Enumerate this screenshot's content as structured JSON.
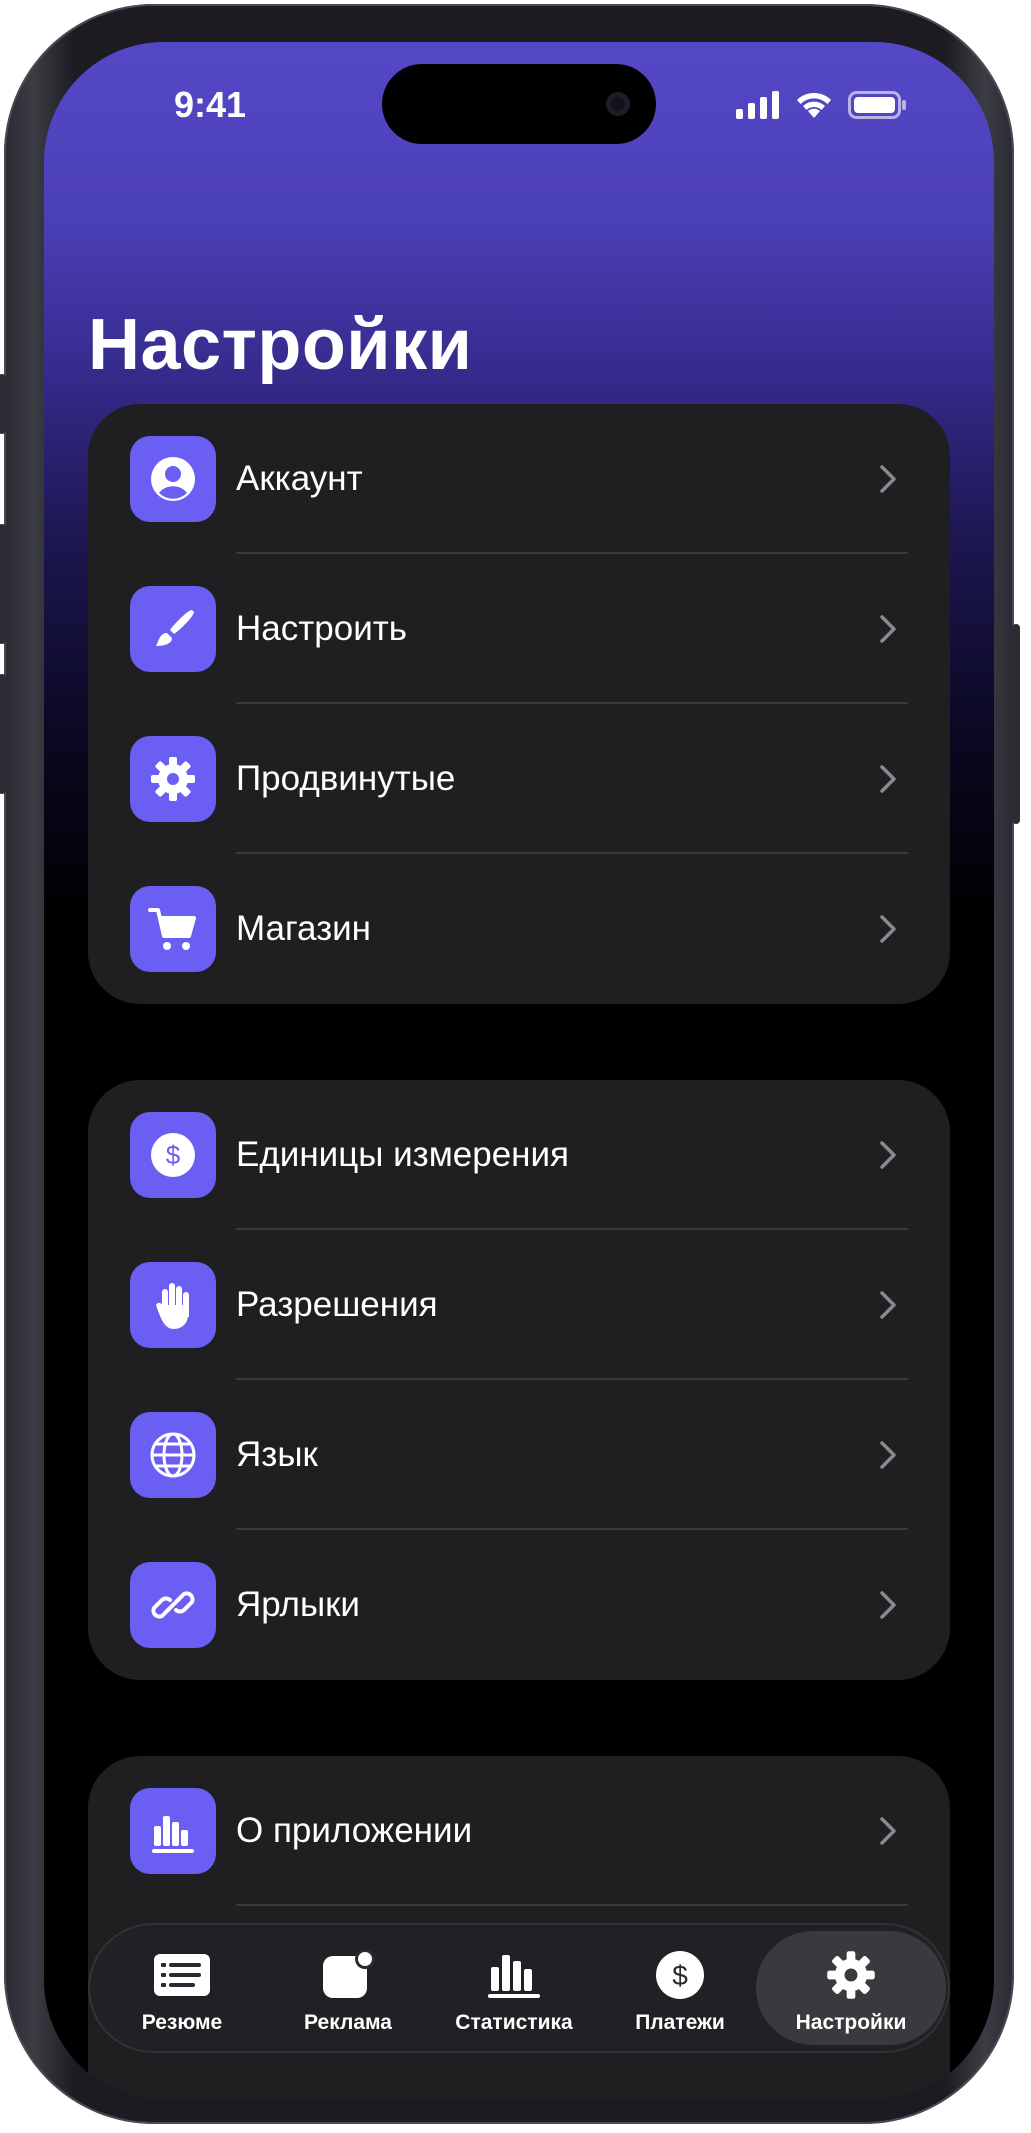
{
  "status_bar": {
    "time": "9:41"
  },
  "header": {
    "title": "Настройки"
  },
  "groups": [
    {
      "items": [
        {
          "label": "Аккаунт",
          "icon": "person-icon"
        },
        {
          "label": "Настроить",
          "icon": "paintbrush-icon"
        },
        {
          "label": "Продвинутые",
          "icon": "gear-icon"
        },
        {
          "label": "Магазин",
          "icon": "cart-icon"
        }
      ]
    },
    {
      "items": [
        {
          "label": "Единицы измерения",
          "icon": "dollar-circle-icon"
        },
        {
          "label": "Разрешения",
          "icon": "hand-icon"
        },
        {
          "label": "Язык",
          "icon": "globe-icon"
        },
        {
          "label": "Ярлыки",
          "icon": "link-icon"
        }
      ]
    },
    {
      "items": [
        {
          "label": "О приложении",
          "icon": "chart-icon"
        }
      ]
    }
  ],
  "tab_bar": {
    "tabs": [
      {
        "label": "Резюме",
        "icon": "list-icon"
      },
      {
        "label": "Реклама",
        "icon": "app-badge-icon"
      },
      {
        "label": "Статистика",
        "icon": "chart-icon"
      },
      {
        "label": "Платежи",
        "icon": "dollar-circle-icon"
      },
      {
        "label": "Настройки",
        "icon": "gear-icon",
        "active": true
      }
    ]
  },
  "colors": {
    "accent": "#6b5ef2",
    "header_gradient_top": "#5548c8",
    "row_background": "#1f1f21",
    "screen_background": "#000000"
  }
}
